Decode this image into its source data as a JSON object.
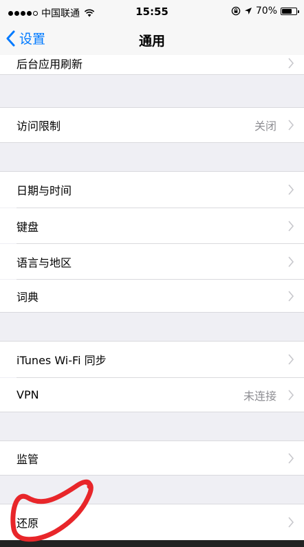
{
  "status_bar": {
    "carrier": "中国联通",
    "time": "15:55",
    "battery": "70%",
    "battery_level": 0.7
  },
  "nav": {
    "back_label": "设置",
    "title": "通用"
  },
  "rows": {
    "background_refresh": {
      "label": "后台应用刷新"
    },
    "restrictions": {
      "label": "访问限制",
      "value": "关闭"
    },
    "date_time": {
      "label": "日期与时间"
    },
    "keyboard": {
      "label": "键盘"
    },
    "language_region": {
      "label": "语言与地区"
    },
    "dictionary": {
      "label": "词典"
    },
    "itunes_wifi_sync": {
      "label": "iTunes Wi-Fi 同步"
    },
    "vpn": {
      "label": "VPN",
      "value": "未连接"
    },
    "supervision": {
      "label": "监管"
    },
    "reset": {
      "label": "还原"
    }
  },
  "colors": {
    "accent": "#007aff",
    "annotation": "#e8262a",
    "group_background": "#efeff4"
  }
}
